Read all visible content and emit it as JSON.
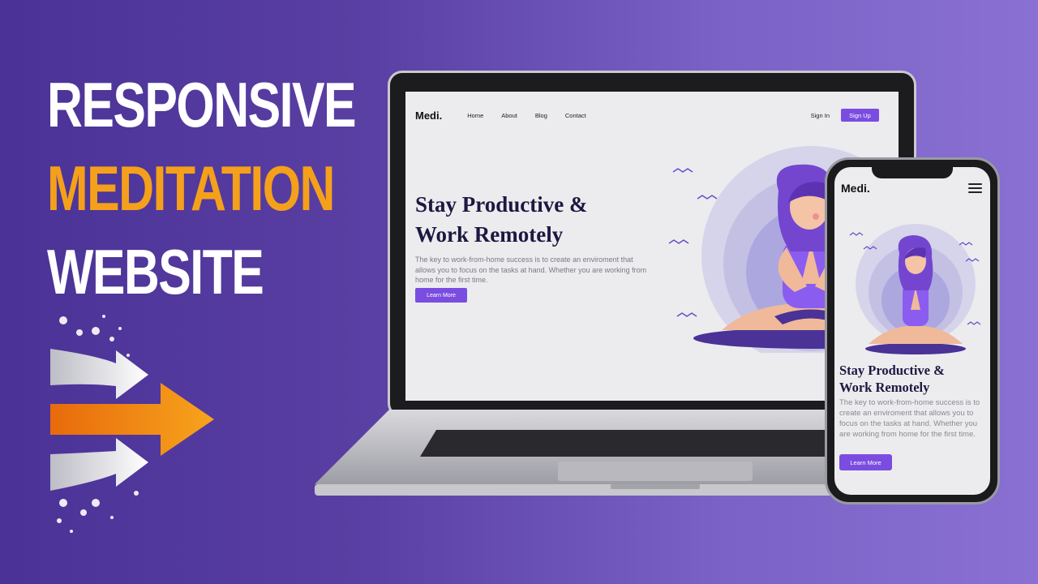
{
  "headline": {
    "line1": "RESPONSIVE",
    "line2": "MEDITATION",
    "line3": "WEBSITE"
  },
  "colors": {
    "accent": "#7a4de0",
    "highlight": "#f5a01b",
    "title": "#1c1840"
  },
  "site": {
    "logo": "Medi.",
    "nav": {
      "home": "Home",
      "about": "About",
      "blog": "Blog",
      "contact": "Contact",
      "sign_in": "Sign In",
      "sign_up": "Sign Up"
    },
    "hero": {
      "title_line1": "Stay Productive &",
      "title_line2": "Work Remotely",
      "description": "The key to work-from-home success is to create an enviroment that allows you to focus on the tasks at hand. Whether you are working from home for the first time.",
      "button": "Learn More"
    }
  },
  "icons": {
    "menu": "hamburger-icon",
    "arrows": "arrows-icon",
    "illustration": "meditation-illustration"
  }
}
